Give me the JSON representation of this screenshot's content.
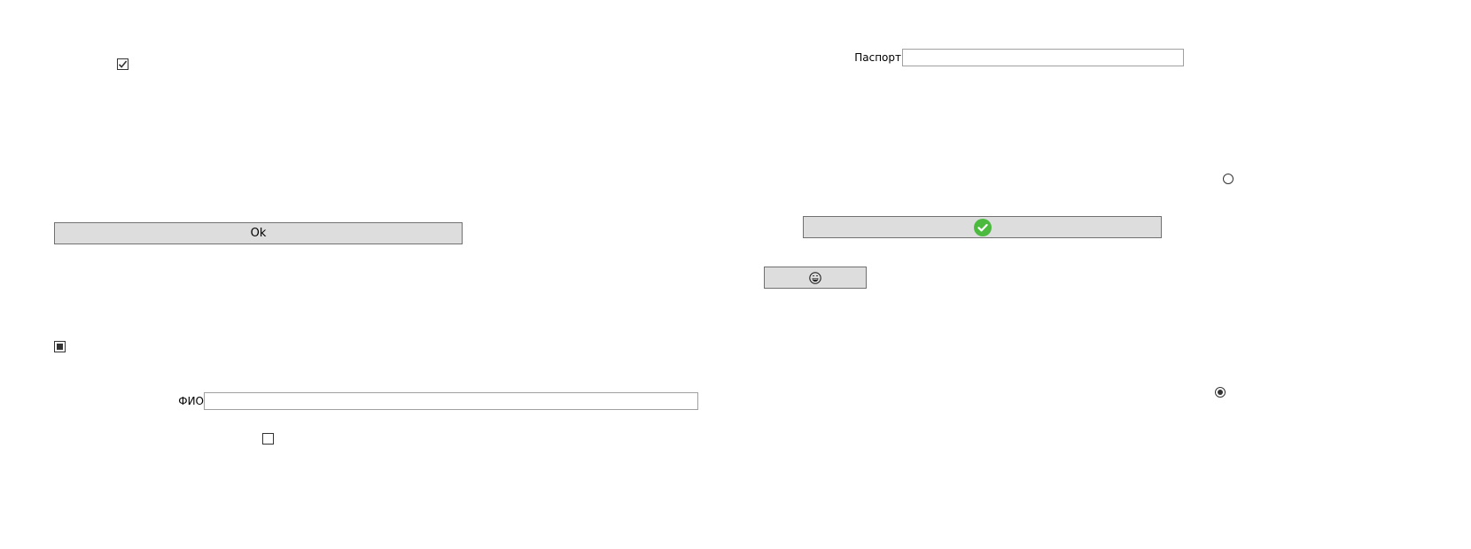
{
  "left_panel": {
    "checkbox_top": {
      "checked": true
    },
    "ok_button": {
      "label": "Ok"
    },
    "checkbox_mid": {
      "state": "indeterminate"
    },
    "fio": {
      "label": "ФИО",
      "value": "",
      "placeholder": ""
    },
    "checkbox_bottom": {
      "checked": false
    }
  },
  "right_panel": {
    "passport": {
      "label": "Паспорт",
      "value": "",
      "placeholder": ""
    },
    "radio_top": {
      "selected": false
    },
    "confirm_button": {
      "icon": "check-circle-icon",
      "icon_color": "#4cba3f"
    },
    "emoji_button": {
      "icon": "grinning-face-icon"
    },
    "radio_bottom": {
      "selected": true
    }
  }
}
